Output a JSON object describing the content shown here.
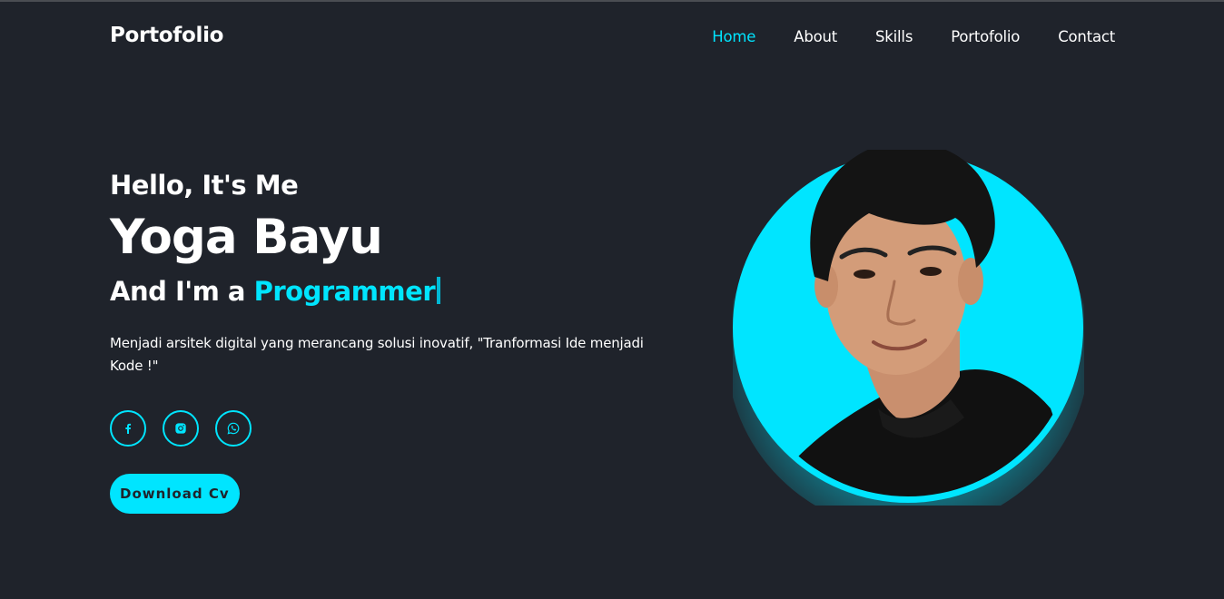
{
  "header": {
    "logo": "Portofolio",
    "nav": [
      {
        "label": "Home",
        "active": true
      },
      {
        "label": "About",
        "active": false
      },
      {
        "label": "Skills",
        "active": false
      },
      {
        "label": "Portofolio",
        "active": false
      },
      {
        "label": "Contact",
        "active": false
      }
    ]
  },
  "hero": {
    "greeting": "Hello, It's Me",
    "name": "Yoga Bayu",
    "role_prefix": "And I'm a",
    "role": "Programmer",
    "description": "Menjadi arsitek digital yang merancang solusi inovatif, \"Tranformasi Ide menjadi Kode !\"",
    "socials": [
      {
        "icon": "facebook-icon"
      },
      {
        "icon": "instagram-icon"
      },
      {
        "icon": "whatsapp-icon"
      }
    ],
    "cta_label": "Download Cv"
  },
  "colors": {
    "background": "#1f232b",
    "accent": "#00e5ff",
    "text": "#ffffff"
  }
}
